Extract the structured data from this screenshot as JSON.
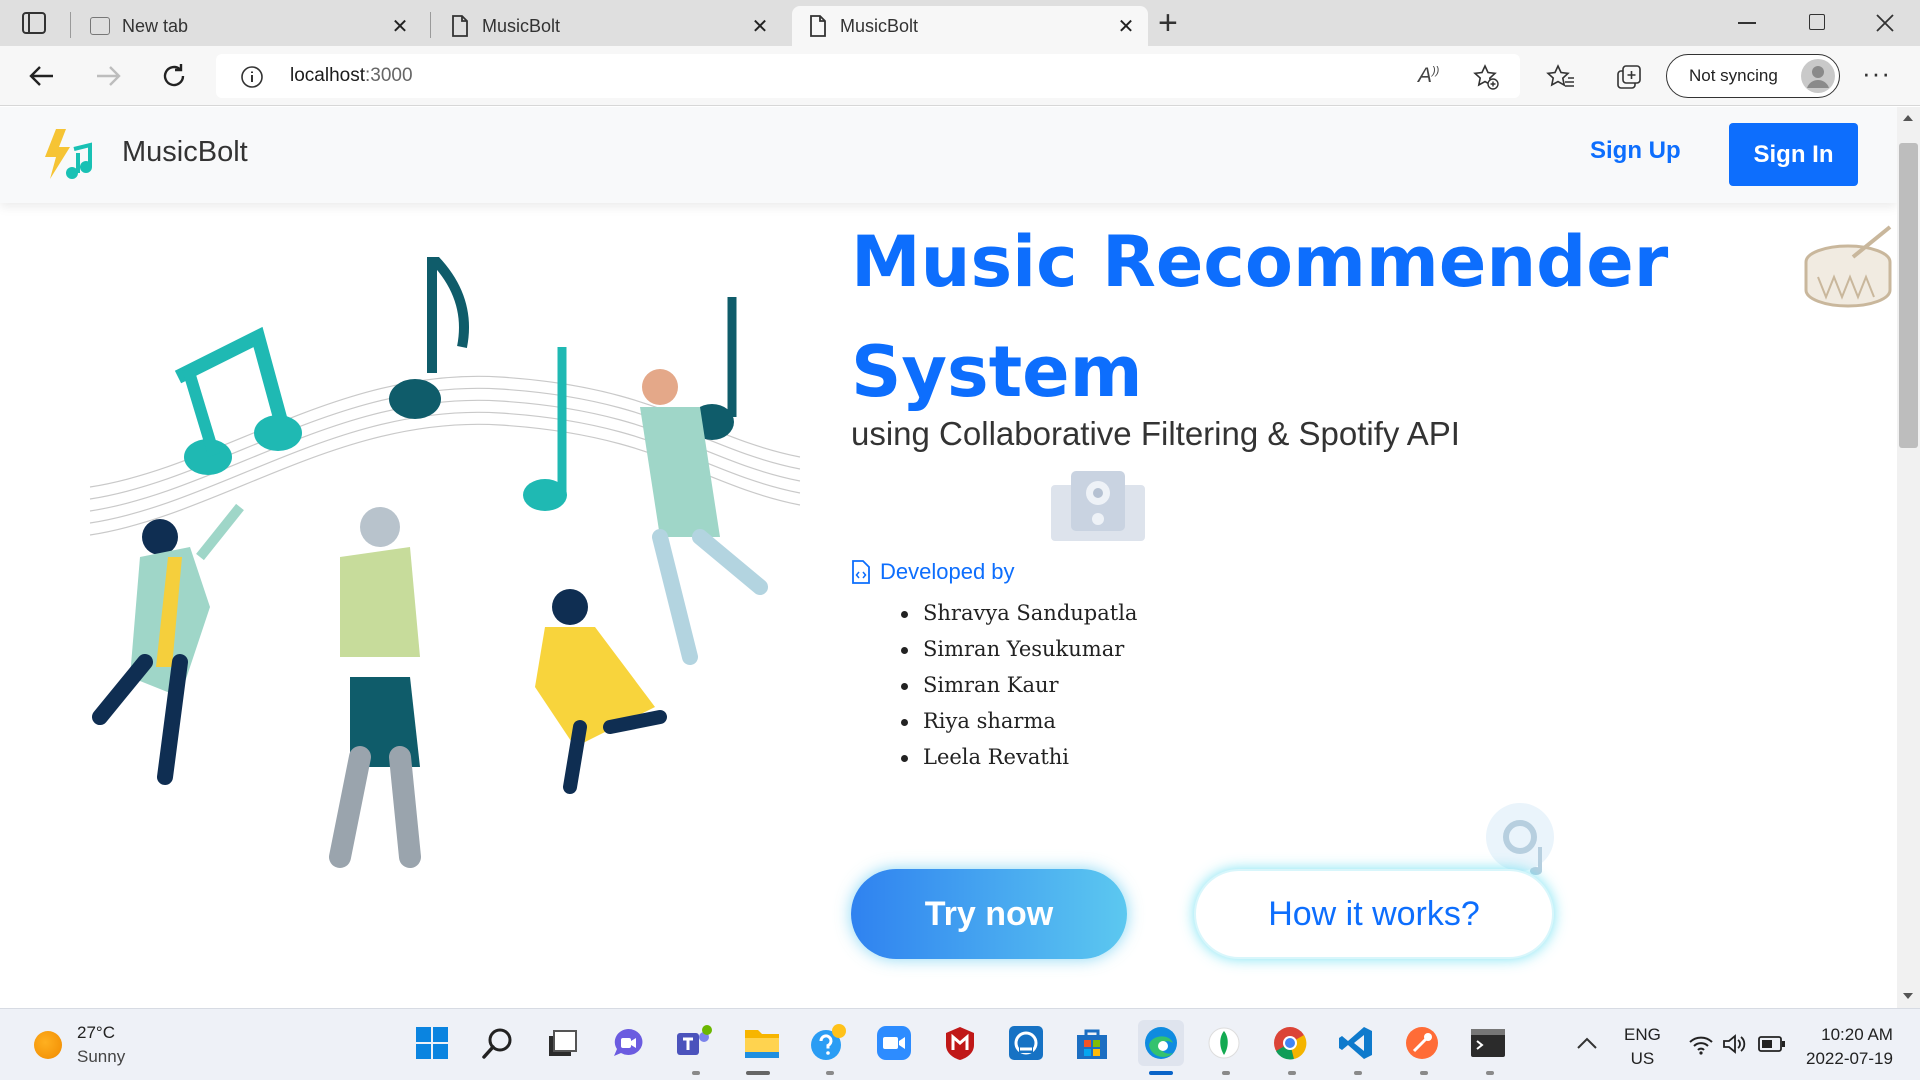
{
  "browser": {
    "tabs": [
      {
        "title": "New tab",
        "icon": "new-tab-page-icon",
        "active": false
      },
      {
        "title": "MusicBolt",
        "icon": "page-icon",
        "active": false
      },
      {
        "title": "MusicBolt",
        "icon": "page-icon",
        "active": true
      }
    ],
    "new_tab_symbol": "+",
    "close_symbol": "✕",
    "window_controls": [
      "minimize",
      "restore",
      "close"
    ],
    "url_host": "localhost",
    "url_port": ":3000",
    "sync_label": "Not syncing"
  },
  "site": {
    "brand": "MusicBolt",
    "signup_label": "Sign Up",
    "signin_label": "Sign In",
    "hero_title_line1": "Music Recommender",
    "hero_title_line2": "System",
    "hero_subtitle": "using Collaborative Filtering & Spotify API",
    "developed_by_label": "Developed by",
    "developers": [
      "Shravya Sandupatla",
      "Simran Yesukumar",
      "Simran Kaur",
      "Riya sharma",
      "Leela Revathi"
    ],
    "try_now_label": "Try now",
    "how_it_works_label": "How it works?",
    "colors": {
      "primary": "#0d6efd",
      "cta_gradient_start": "#2f82f0",
      "cta_gradient_end": "#5cc8f0",
      "pointer": "#ff1010"
    }
  },
  "taskbar": {
    "weather_temp": "27°C",
    "weather_condition": "Sunny",
    "apps": [
      "start-icon",
      "search-icon",
      "task-view-icon",
      "chat-icon",
      "teams-icon",
      "file-explorer-icon",
      "help-icon",
      "zoom-icon",
      "mcafee-icon",
      "app-icon",
      "store-icon",
      "edge-icon",
      "mongodb-compass-icon",
      "chrome-icon",
      "vscode-icon",
      "postman-icon",
      "terminal-icon"
    ],
    "lang_line1": "ENG",
    "lang_line2": "US",
    "time": "10:20 AM",
    "date": "2022-07-19"
  }
}
